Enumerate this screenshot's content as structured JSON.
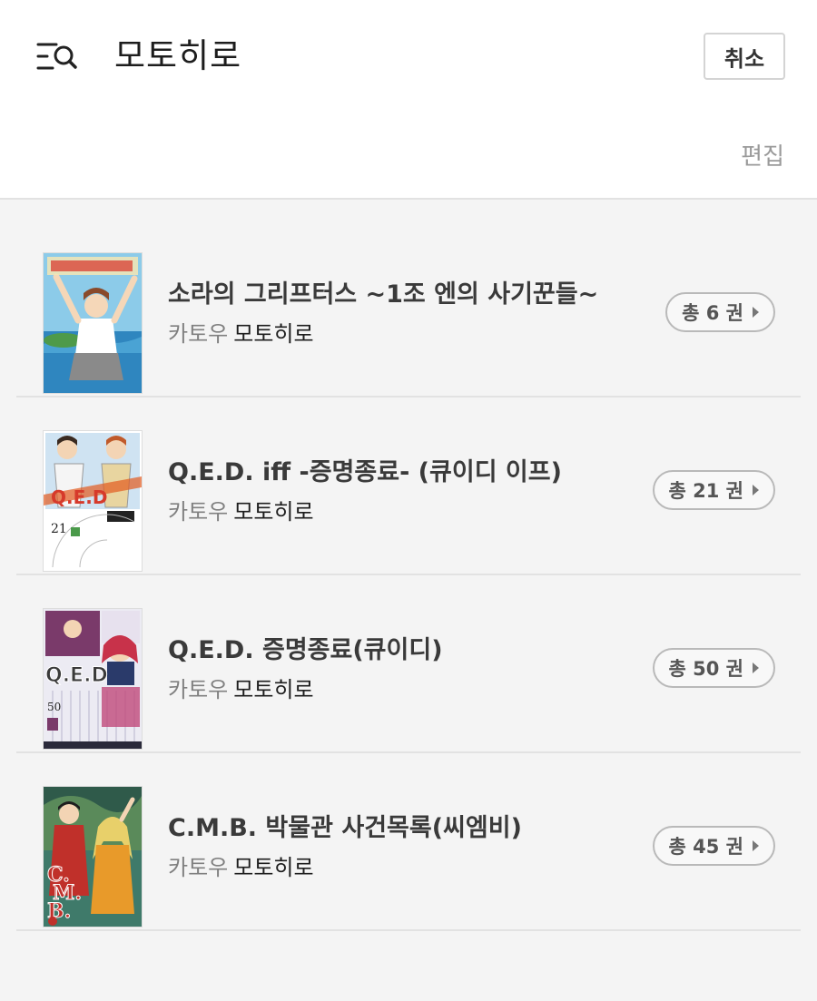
{
  "header": {
    "query": "모토히로",
    "cancel_label": "취소",
    "edit_label": "편집"
  },
  "results": [
    {
      "title": "소라의 그리프터스 ~1조 엔의 사기꾼들~",
      "author_role": "카토우",
      "author_name": "모토히로",
      "volumes": "총 6 권",
      "cover_icon": "manga-cover-sora",
      "cover_colors": [
        "#7fc4e8",
        "#2a7fb8",
        "#f0e3b0"
      ]
    },
    {
      "title": "Q.E.D. iff -증명종료- (큐이디 이프)",
      "author_role": "카토우",
      "author_name": "모토히로",
      "volumes": "총 21 권",
      "cover_icon": "manga-cover-qed-iff",
      "cover_colors": [
        "#ffffff",
        "#d63a2b",
        "#3a6fb0"
      ]
    },
    {
      "title": "Q.E.D. 증명종료(큐이디)",
      "author_role": "카토우",
      "author_name": "모토히로",
      "volumes": "총 50 권",
      "cover_icon": "manga-cover-qed",
      "cover_colors": [
        "#7a3a6a",
        "#e8e8f0",
        "#c8324a"
      ]
    },
    {
      "title": "C.M.B. 박물관 사건목록(씨엠비)",
      "author_role": "카토우",
      "author_name": "모토히로",
      "volumes": "총 45 권",
      "cover_icon": "manga-cover-cmb",
      "cover_colors": [
        "#3f7a6a",
        "#e89a2a",
        "#c0302a"
      ]
    }
  ]
}
